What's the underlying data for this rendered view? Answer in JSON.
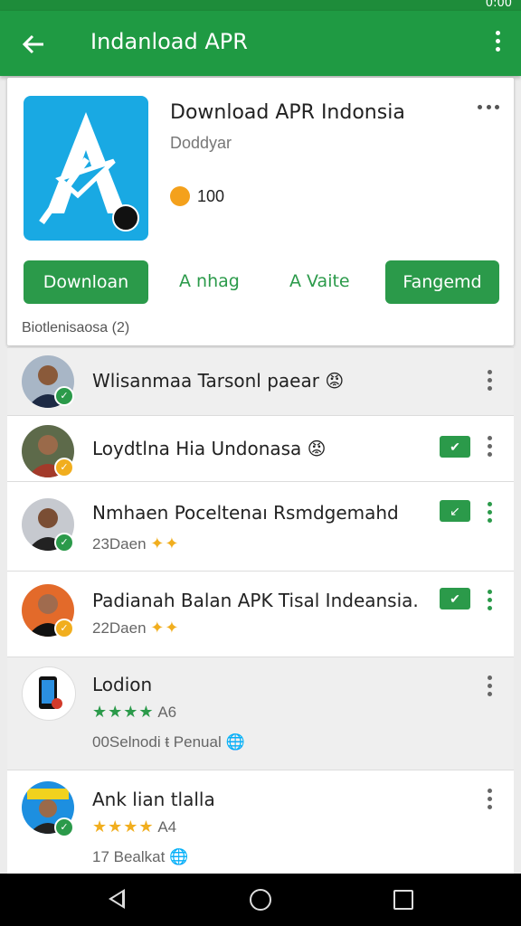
{
  "status": {
    "time": "0:00"
  },
  "appbar": {
    "title": "Indanload APR",
    "back_icon": "arrow-back-icon",
    "more_icon": "more-vert-icon"
  },
  "app_card": {
    "title": "Download APR Indonsia",
    "developer": "Doddyar",
    "coins": "100",
    "buttons": {
      "download": "Downloan",
      "manage": "A nhag",
      "value": "A Vaite",
      "engage": "Fangemd"
    },
    "footer": "Biotlenisaosa (2)"
  },
  "list": [
    {
      "title": "Wlisanmaa Tarsonl paear",
      "emoji": "😡",
      "badge_color": "#2b9a4a"
    },
    {
      "title": "Loydtlna Hia Undonasa",
      "emoji": "😡",
      "badge_color": "#f1ae1e",
      "action": "installed"
    },
    {
      "title": "Nmhaen Poceltenaı Rsmdgemahd",
      "sub": "23Daen",
      "badge_color": "#2b9a4a",
      "action": "installed"
    },
    {
      "title": "Padianah Balan APK Tisal Indeansia.",
      "sub": "22Daen",
      "badge_color": "#f1ae1e",
      "action": "installed"
    },
    {
      "title": "Lodion",
      "stars": "★★★★",
      "rating": "A6",
      "sub": "00Selnodi ŧ Penual",
      "icon": "phone-icon"
    },
    {
      "title": "Ank lian tlalla",
      "stars": "★★★★",
      "rating": "A4",
      "sub": "17 Bealkat",
      "badge_color": "#2b9a4a"
    }
  ],
  "colors": {
    "primary": "#1f9a43",
    "accent": "#2b9a4a",
    "icon_bg": "#19a9e3",
    "star": "#f1ae1e"
  }
}
